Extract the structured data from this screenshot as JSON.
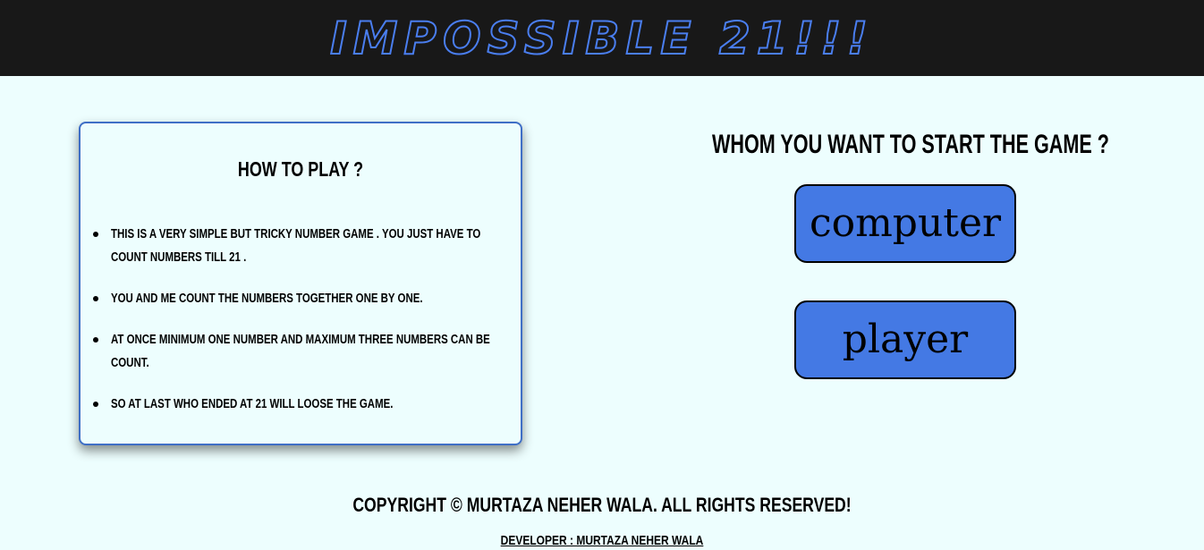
{
  "header": {
    "title": "IMPOSSIBLE 21!!!"
  },
  "howto": {
    "title": "HOW TO PLAY ?",
    "rules": [
      "THIS IS A VERY SIMPLE BUT TRICKY NUMBER GAME . YOU JUST HAVE TO COUNT NUMBERS TILL 21 .",
      "YOU AND ME COUNT THE NUMBERS TOGETHER ONE BY ONE.",
      "AT ONCE MINIMUM ONE NUMBER AND MAXIMUM THREE NUMBERS CAN BE COUNT.",
      "SO AT LAST WHO ENDED AT 21 WILL LOOSE THE GAME."
    ]
  },
  "start": {
    "prompt": "WHOM YOU WANT TO START THE GAME ?",
    "computer_label": "computer",
    "player_label": "player"
  },
  "footer": {
    "copyright": "COPYRIGHT © MURTAZA NEHER WALA. ALL RIGHTS RESERVED!",
    "developer": "DEVELOPER : MURTAZA NEHER WALA"
  },
  "colors": {
    "header_bg": "#181818",
    "title_outline": "#4a7ef0",
    "page_bg": "#edfefe",
    "button_bg": "#4479e4",
    "card_border": "#3f6fc6"
  }
}
